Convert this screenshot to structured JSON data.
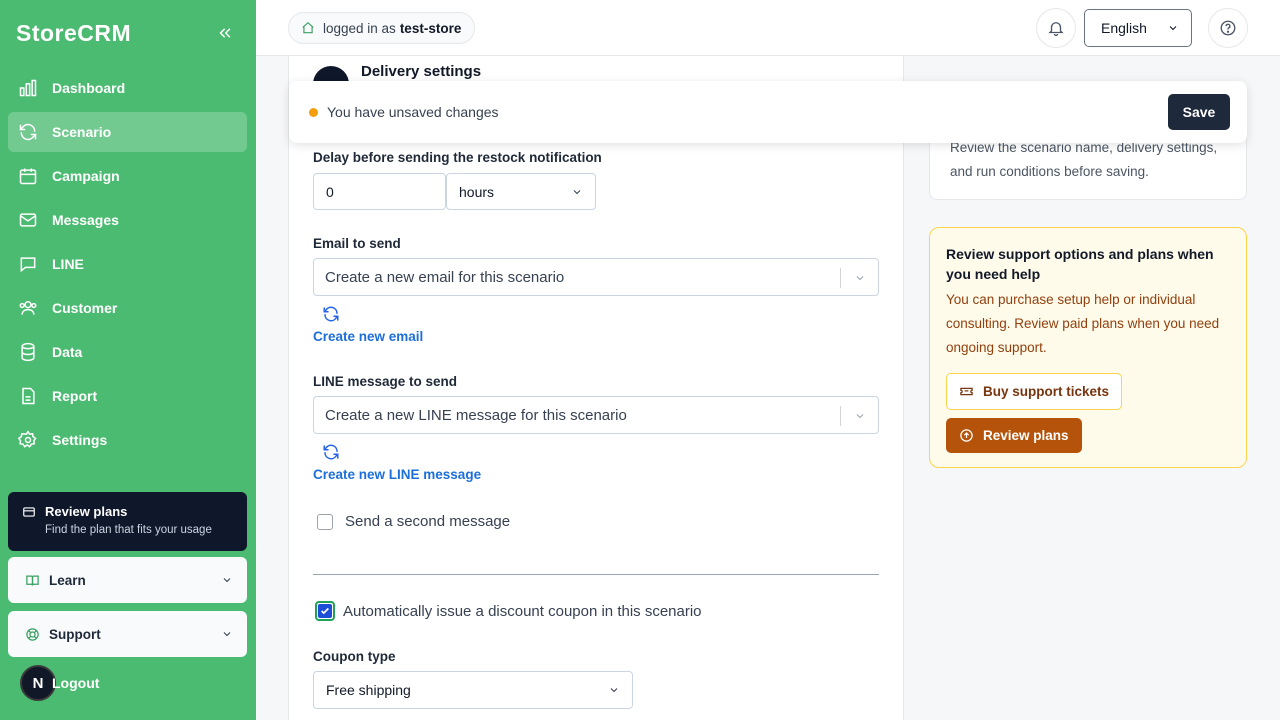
{
  "app": {
    "name": "StoreCRM"
  },
  "sidebar": {
    "items": [
      {
        "label": "Dashboard",
        "icon": "bar-chart-icon"
      },
      {
        "label": "Scenario",
        "icon": "refresh-icon",
        "active": true
      },
      {
        "label": "Campaign",
        "icon": "calendar-icon"
      },
      {
        "label": "Messages",
        "icon": "mail-icon"
      },
      {
        "label": "LINE",
        "icon": "chat-bubble-icon"
      },
      {
        "label": "Customer",
        "icon": "users-icon"
      },
      {
        "label": "Data",
        "icon": "database-icon"
      },
      {
        "label": "Report",
        "icon": "file-report-icon"
      },
      {
        "label": "Settings",
        "icon": "gear-icon"
      }
    ],
    "promo": {
      "title": "Review plans",
      "subtitle": "Find the plan that fits your usage"
    },
    "learn": "Learn",
    "support": "Support",
    "avatar": "N",
    "logout": "Logout"
  },
  "topbar": {
    "logged_in_prefix": "logged in as",
    "store": "test-store",
    "language": "English"
  },
  "form": {
    "section_title": "Delivery settings",
    "delay_label": "Delay before sending the restock notification",
    "delay_value": "0",
    "delay_unit": "hours",
    "email_label": "Email to send",
    "email_select": "Create a new email for this scenario",
    "email_link": "Create new email",
    "line_label": "LINE message to send",
    "line_select": "Create a new LINE message for this scenario",
    "line_link": "Create new LINE message",
    "second_message": "Send a second message",
    "second_message_checked": false,
    "coupon_toggle": "Automatically issue a discount coupon in this scenario",
    "coupon_toggle_checked": true,
    "coupon_type_label": "Coupon type",
    "coupon_type_value": "Free shipping"
  },
  "unsaved": {
    "message": "You have unsaved changes",
    "save": "Save",
    "dot_color": "#f59e0b"
  },
  "right": {
    "summary_text": "Review the scenario name, delivery settings, and run conditions before saving.",
    "support_title": "Review support options and plans when you need help",
    "support_body": "You can purchase setup help or individual consulting. Review paid plans when you need ongoing support.",
    "buy_tickets": "Buy support tickets",
    "review_plans": "Review plans"
  },
  "colors": {
    "sidebar": "#4cbb72",
    "primary_dark": "#1e293b",
    "link": "#1d6fd8",
    "warning_bg": "#fffbeb",
    "warning_button": "#b45309"
  }
}
